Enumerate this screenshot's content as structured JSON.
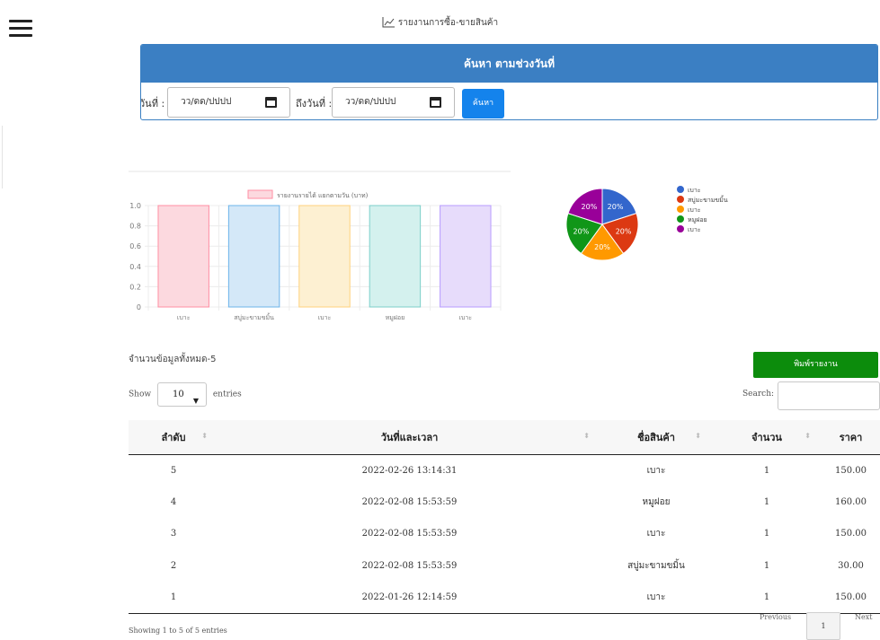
{
  "header": {
    "title": "รายงานการซื้อ-ขายสินค้า",
    "title_icon": "chart-line-icon"
  },
  "search_panel": {
    "heading": "ค้นหา ตามช่วงวันที่",
    "from_label": "วันที่ :",
    "from_value": "วว/ดด/ปปปป",
    "to_label": "ถึงวันที่ :",
    "to_value": "วว/ดด/ปปปป",
    "button": "ค้นหา"
  },
  "chart_data": [
    {
      "type": "bar",
      "legend": "รายงานรายได้ แยกตามวัน (บาท)",
      "categories": [
        "เบาะ",
        "สบู่มะขามขมิ้น",
        "เบาะ",
        "หมูฝอย",
        "เบาะ"
      ],
      "values": [
        1,
        1,
        1,
        1,
        1
      ],
      "yticks": [
        "1.0",
        "0.8",
        "0.6",
        "0.4",
        "0.2",
        "0"
      ],
      "ylim": [
        0,
        1
      ],
      "fills": [
        "#fcd9df",
        "#d4e8f8",
        "#fdf0d2",
        "#d4f1ee",
        "#e7dcfb"
      ],
      "strokes": [
        "#ff8ea3",
        "#6cb4ea",
        "#ffd27c",
        "#7ccfca",
        "#b79bff"
      ]
    },
    {
      "type": "pie",
      "labels": [
        "เบาะ",
        "สบู่มะขามขมิ้น",
        "เบาะ",
        "หมูฝอย",
        "เบาะ"
      ],
      "values": [
        20,
        20,
        20,
        20,
        20
      ],
      "slice_labels": [
        "20%",
        "20%",
        "20%",
        "20%",
        "20%"
      ],
      "colors": [
        "#3366cc",
        "#dc3912",
        "#ff9900",
        "#109618",
        "#990099"
      ]
    }
  ],
  "summary": {
    "count_text": "จำนวนข้อมูลทั้งหมด-5",
    "print_button": "พิมพ์รายงาน"
  },
  "table_controls": {
    "show": "Show",
    "entries_value": "10",
    "entries": "entries",
    "search_label": "Search:"
  },
  "table": {
    "headers": [
      "ลำดับ",
      "วันที่และเวลา",
      "ชื่อสินค้า",
      "จำนวน",
      "ราคา"
    ],
    "rows": [
      [
        "5",
        "2022-02-26 13:14:31",
        "เบาะ",
        "1",
        "150.00"
      ],
      [
        "4",
        "2022-02-08 15:53:59",
        "หมูฝอย",
        "1",
        "160.00"
      ],
      [
        "3",
        "2022-02-08 15:53:59",
        "เบาะ",
        "1",
        "150.00"
      ],
      [
        "2",
        "2022-02-08 15:53:59",
        "สบู่มะขามขมิ้น",
        "1",
        "30.00"
      ],
      [
        "1",
        "2022-01-26 12:14:59",
        "เบาะ",
        "1",
        "150.00"
      ]
    ]
  },
  "footer": {
    "info": "Showing 1 to 5 of 5 entries",
    "previous": "Previous",
    "page": "1",
    "next": "Next"
  }
}
